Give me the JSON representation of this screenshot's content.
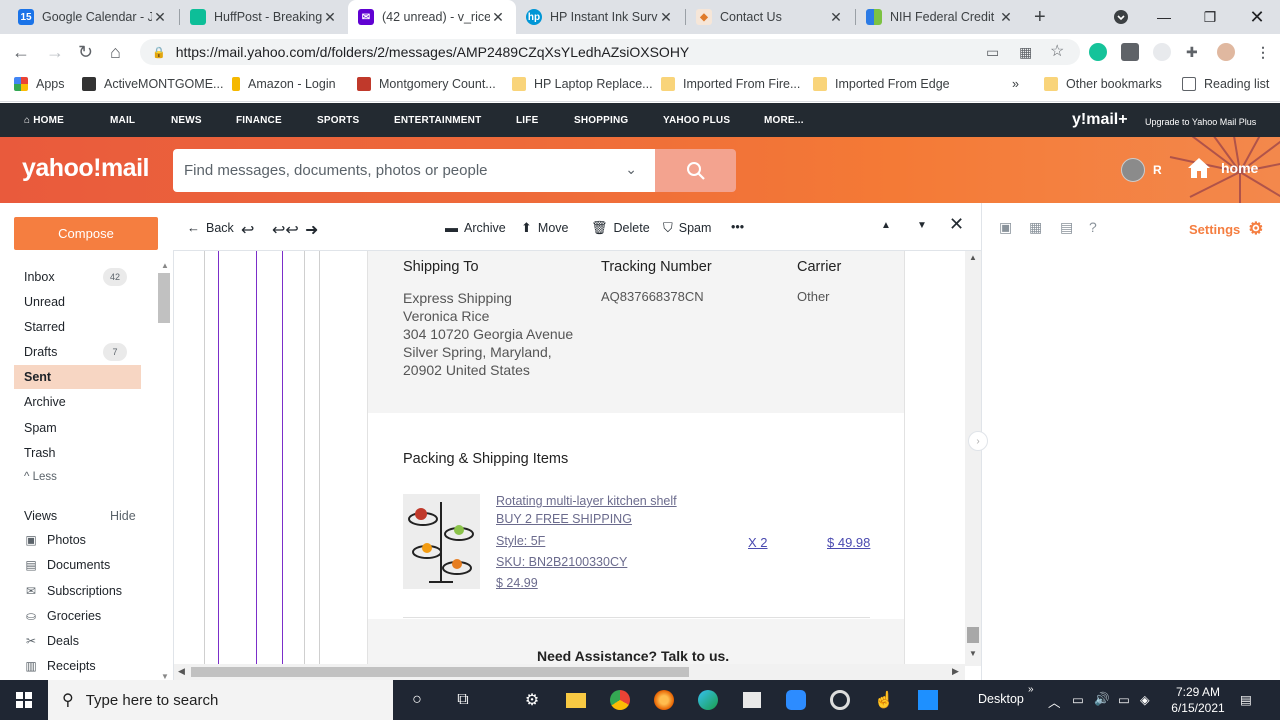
{
  "browser": {
    "tabs": [
      {
        "title": "Google Calendar - J",
        "fav_color": "#1a73e8",
        "fav_text": "15"
      },
      {
        "title": "HuffPost - Breaking",
        "fav_color": "#0dbe98",
        "fav_text": ""
      },
      {
        "title": "(42 unread) - v_rice",
        "fav_color": "#6001d2",
        "fav_text": ""
      },
      {
        "title": "HP Instant Ink Surve",
        "fav_color": "#0096d6",
        "fav_text": "hp"
      },
      {
        "title": "Contact Us",
        "fav_color": "#f2f2f2",
        "fav_text": ""
      },
      {
        "title": "NIH Federal Credit",
        "fav_color": "#ffffff",
        "fav_text": ""
      }
    ],
    "url": "https://mail.yahoo.com/d/folders/2/messages/AMP2489CZqXsYLedhAZsiOXSOHY",
    "bookmarks": [
      "Apps",
      "ActiveMONTGOME...",
      "Amazon - Login",
      "Montgomery Count...",
      "HP Laptop Replace...",
      "Imported From Fire...",
      "Imported From Edge",
      "»",
      "Other bookmarks",
      "Reading list"
    ]
  },
  "yahoo_nav": {
    "items": [
      "HOME",
      "MAIL",
      "NEWS",
      "FINANCE",
      "SPORTS",
      "ENTERTAINMENT",
      "LIFE",
      "SHOPPING",
      "YAHOO PLUS",
      "MORE..."
    ],
    "brand": "y!mail+",
    "upgrade": "Upgrade to Yahoo Mail Plus"
  },
  "header": {
    "logo": "yahoo!mail",
    "search_placeholder": "Find messages, documents, photos or people",
    "user_initial": "R",
    "home": "home"
  },
  "sidebar": {
    "compose": "Compose",
    "folders": [
      {
        "label": "Inbox",
        "count": "42"
      },
      {
        "label": "Unread",
        "count": ""
      },
      {
        "label": "Starred",
        "count": ""
      },
      {
        "label": "Drafts",
        "count": "7"
      },
      {
        "label": "Sent",
        "count": ""
      },
      {
        "label": "Archive",
        "count": ""
      },
      {
        "label": "Spam",
        "count": ""
      },
      {
        "label": "Trash",
        "count": ""
      },
      {
        "label": "^ Less",
        "count": ""
      }
    ],
    "views_title": "Views",
    "hide": "Hide",
    "views": [
      "Photos",
      "Documents",
      "Subscriptions",
      "Groceries",
      "Deals",
      "Receipts"
    ]
  },
  "message_toolbar": {
    "back": "Back",
    "archive": "Archive",
    "move": "Move",
    "delete": "Delete",
    "spam": "Spam",
    "more": "•••"
  },
  "message": {
    "shipping_to_label": "Shipping To",
    "tracking_label": "Tracking Number",
    "carrier_label": "Carrier",
    "address": [
      "Express Shipping",
      "Veronica Rice",
      "304 10720 Georgia Avenue",
      "Silver Spring, Maryland,",
      "20902 United States"
    ],
    "tracking_number": "AQ837668378CN",
    "carrier": "Other",
    "packing_title": "Packing & Shipping Items",
    "item": {
      "name": "Rotating multi-layer kitchen shelf",
      "promo": "BUY 2 FREE SHIPPING",
      "style": "Style: 5F",
      "sku": "SKU: BN2B2100330CY",
      "price": "$ 24.99",
      "qty": "X 2",
      "total": "$ 49.98"
    },
    "assistance": "Need Assistance? Talk to us."
  },
  "right_panel": {
    "settings": "Settings"
  },
  "taskbar": {
    "search_placeholder": "Type here to search",
    "desktop": "Desktop",
    "time": "7:29 AM",
    "date": "6/15/2021"
  }
}
